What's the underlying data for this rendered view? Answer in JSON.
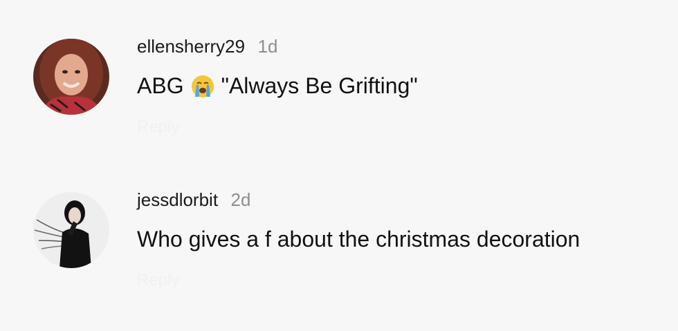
{
  "comments": [
    {
      "username": "ellensherry29",
      "time": "1d",
      "text_before": "ABG",
      "emoji": "loudly-crying-face-icon",
      "text_after": "\"Always Be Grifting\"",
      "reply_label": "Reply"
    },
    {
      "username": "jessdlorbit",
      "time": "2d",
      "text": "Who gives a f about the christmas decoration",
      "reply_label": "Reply"
    }
  ],
  "colors": {
    "background": "#f7f7f7",
    "username": "#1a1a1a",
    "time": "#8e8e8e",
    "text": "#111111"
  }
}
